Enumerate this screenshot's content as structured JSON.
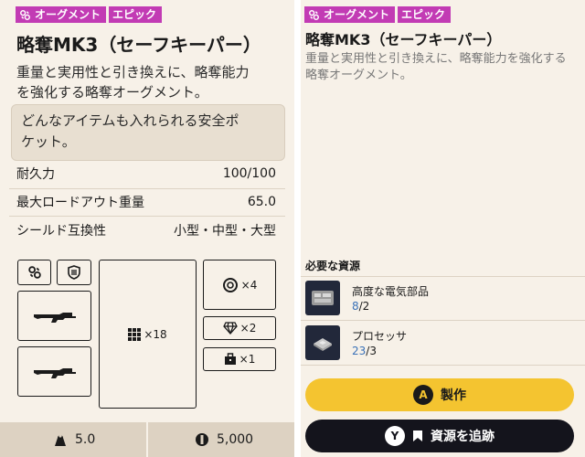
{
  "item": {
    "tag_type": "オーグメント",
    "tag_rarity": "エピック",
    "title": "略奪MK3（セーフキーパー）",
    "description": "重量と実用性と引き換えに、略奪能力\nを強化する略奪オーグメント。",
    "description_right": "重量と実用性と引き換えに、略奪能力を強化する\n略奪オーグメント。",
    "flavor": "どんなアイテムも入れられる安全ポ\nケット。"
  },
  "stats": [
    {
      "label": "耐久力",
      "value": "100/100"
    },
    {
      "label": "最大ロードアウト重量",
      "value": "65.0"
    },
    {
      "label": "シールド互換性",
      "value": "小型・中型・大型"
    }
  ],
  "slots": {
    "backpack_count": "×18",
    "safe_count": "×4",
    "gem_count": "×2",
    "case_count": "×1"
  },
  "footer": {
    "weight": "5.0",
    "price": "5,000"
  },
  "requirements": {
    "title": "必要な資源",
    "items": [
      {
        "name": "高度な電気部品",
        "have": "8",
        "need": "/2",
        "icon": "electrical-parts-icon"
      },
      {
        "name": "プロセッサ",
        "have": "23",
        "need": "/3",
        "icon": "processor-icon"
      }
    ]
  },
  "buttons": {
    "craft_key": "A",
    "craft_label": "製作",
    "track_key": "Y",
    "track_label": "資源を追跡"
  },
  "colors": {
    "panel": "#f7f1e8",
    "tag": "#c23bb4",
    "accent": "#f4c430",
    "count_blue": "#3b72b8"
  }
}
